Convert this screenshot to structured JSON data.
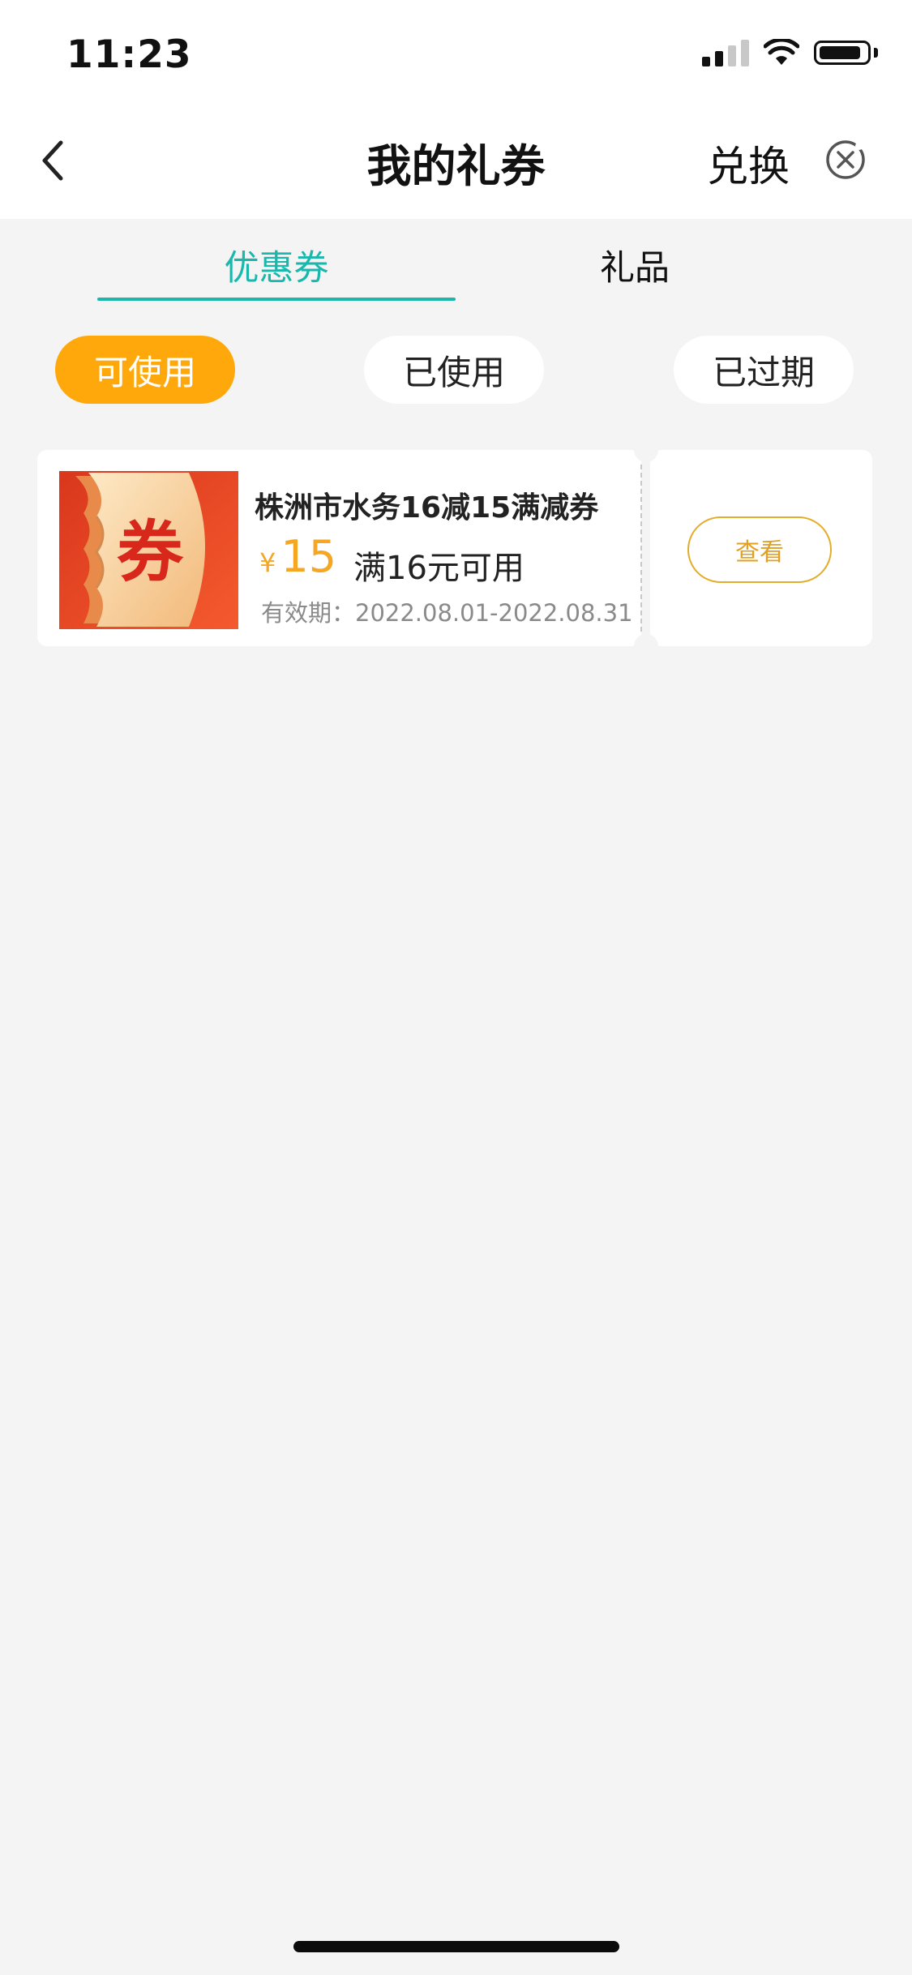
{
  "status_bar": {
    "time": "11:23",
    "icons": [
      "signal-icon",
      "wifi-icon",
      "battery-icon"
    ]
  },
  "nav": {
    "back_icon": "chevron-left-icon",
    "title": "我的礼券",
    "redeem_label": "兑换",
    "close_icon": "close-circle-icon"
  },
  "tabs": [
    {
      "label": "优惠券",
      "active": true
    },
    {
      "label": "礼品",
      "active": false
    }
  ],
  "filters": [
    {
      "label": "可使用",
      "active": true
    },
    {
      "label": "已使用",
      "active": false
    },
    {
      "label": "已过期",
      "active": false
    }
  ],
  "coupons": [
    {
      "image_icon": "coupon-ticket-icon",
      "image_text": "券",
      "title": "株洲市水务16减15满减券",
      "currency": "¥",
      "amount": "15",
      "condition": "满16元可用",
      "validity": "有效期：2022.08.01-2022.08.31",
      "action_label": "查看"
    }
  ],
  "colors": {
    "accent_teal": "#19b7ac",
    "accent_orange": "#ffa80b",
    "price_orange": "#f5a623",
    "background": "#f4f4f4"
  }
}
